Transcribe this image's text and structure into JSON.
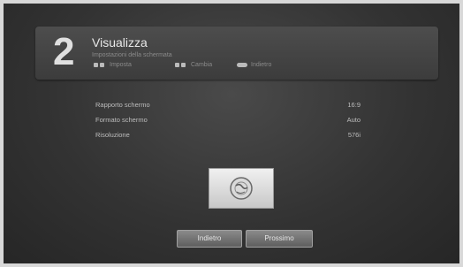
{
  "header": {
    "step_number": "2",
    "title": "Visualizza",
    "description": "Impostazioni della schermata",
    "hints": [
      {
        "label": "Imposta"
      },
      {
        "label": "Cambia"
      },
      {
        "label": "Indietro"
      }
    ]
  },
  "settings": [
    {
      "label": "Rapporto schermo",
      "value": "16:9"
    },
    {
      "label": "Formato schermo",
      "value": "Auto"
    },
    {
      "label": "Risoluzione",
      "value": "576i"
    }
  ],
  "buttons": {
    "back": "Indietro",
    "next": "Prossimo"
  }
}
